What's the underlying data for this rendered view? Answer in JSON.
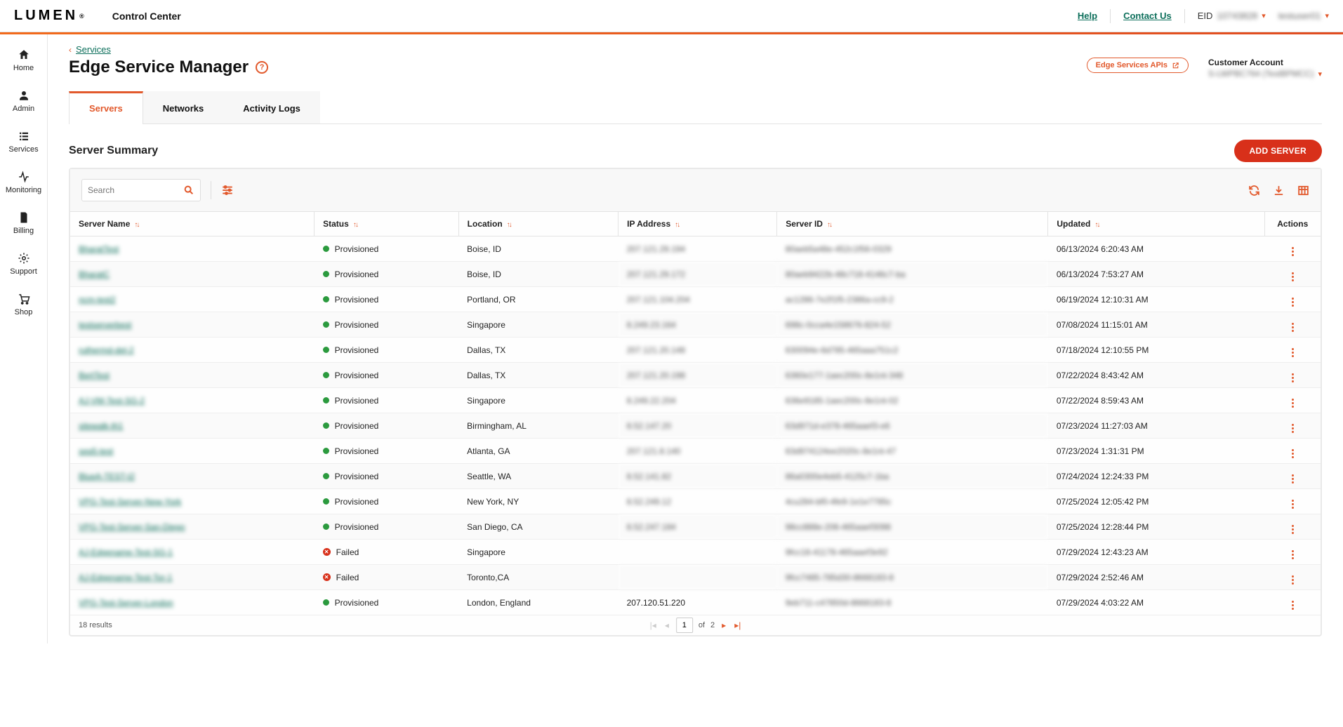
{
  "topbar": {
    "logo_text": "LUMEN",
    "product": "Control Center",
    "help": "Help",
    "contact": "Contact Us",
    "eid_label": "EID",
    "eid_value": "10743828",
    "user_name": "testuser01"
  },
  "sidenav": [
    {
      "label": "Home"
    },
    {
      "label": "Admin"
    },
    {
      "label": "Services"
    },
    {
      "label": "Monitoring"
    },
    {
      "label": "Billing"
    },
    {
      "label": "Support"
    },
    {
      "label": "Shop"
    }
  ],
  "breadcrumb": {
    "parent": "Services"
  },
  "page": {
    "title": "Edge Service Manager",
    "apis_btn": "Edge Services APIs",
    "customer_account_label": "Customer Account",
    "customer_account_value": "S-LWPBC764  (TestBPMCC)"
  },
  "tabs": [
    {
      "label": "Servers",
      "active": true
    },
    {
      "label": "Networks",
      "active": false
    },
    {
      "label": "Activity Logs",
      "active": false
    }
  ],
  "summary": {
    "title": "Server Summary",
    "add_btn": "ADD SERVER",
    "search_placeholder": "Search",
    "columns": [
      "Server Name",
      "Status",
      "Location",
      "IP Address",
      "Server ID",
      "Updated",
      "Actions"
    ],
    "rows": [
      {
        "name": "BharatTest",
        "status": "Provisioned",
        "status_kind": "ok",
        "location": "Boise, ID",
        "ip": "207.121.29.194",
        "server_id": "80aeb5a48e-452c1f56-0329",
        "updated": "06/13/2024 6:20:43 AM"
      },
      {
        "name": "BharatC",
        "status": "Provisioned",
        "status_kind": "ok",
        "location": "Boise, ID",
        "ip": "207.121.29.172",
        "server_id": "80aeb9422b-48c718-4146c7-ba",
        "updated": "06/13/2024 7:53:27 AM"
      },
      {
        "name": "ncm-test2",
        "status": "Provisioned",
        "status_kind": "ok",
        "location": "Portland, OR",
        "ip": "207.121.104.204",
        "server_id": "ac1286-7e2f1f5-2386a-cc9-2",
        "updated": "06/19/2024 12:10:31 AM"
      },
      {
        "name": "testserverbest",
        "status": "Provisioned",
        "status_kind": "ok",
        "location": "Singapore",
        "ip": "8.249.23.164",
        "server_id": "698c-0cca4e158676-824-52",
        "updated": "07/08/2024 11:15:01 AM"
      },
      {
        "name": "ruthermd-del-2",
        "status": "Provisioned",
        "status_kind": "ok",
        "location": "Dallas, TX",
        "ip": "207.121.20.148",
        "server_id": "630094e-6d785-465aaa751c2",
        "updated": "07/18/2024 12:10:55 PM"
      },
      {
        "name": "BertTest",
        "status": "Provisioned",
        "status_kind": "ok",
        "location": "Dallas, TX",
        "ip": "207.121.20.198",
        "server_id": "6360e177-1aec200c-8e1nt-348",
        "updated": "07/22/2024 8:43:42 AM"
      },
      {
        "name": "AJ-VM-Test-SG-2",
        "status": "Provisioned",
        "status_kind": "ok",
        "location": "Singapore",
        "ip": "8.249.22.204",
        "server_id": "636e9185-1aec200c-8e1nt-02",
        "updated": "07/22/2024 8:59:43 AM"
      },
      {
        "name": "sitewalk-th1",
        "status": "Provisioned",
        "status_kind": "ok",
        "location": "Birmingham, AL",
        "ip": "8.52.147.20",
        "server_id": "63d971d-e378-465aaef3-e6",
        "updated": "07/23/2024 11:27:03 AM"
      },
      {
        "name": "seq5-test",
        "status": "Provisioned",
        "status_kind": "ok",
        "location": "Atlanta, GA",
        "ip": "207.121.8.140",
        "server_id": "63d974124ee2020c-8e1nt-47",
        "updated": "07/23/2024 1:31:31 PM"
      },
      {
        "name": "BlueA-TEST-t2",
        "status": "Provisioned",
        "status_kind": "ok",
        "location": "Seattle, WA",
        "ip": "8.52.141.82",
        "server_id": "86a0300e4eb5-4125c7-1ba",
        "updated": "07/24/2024 12:24:33 PM"
      },
      {
        "name": "VPG-Test-Server-New-York",
        "status": "Provisioned",
        "status_kind": "ok",
        "location": "New York, NY",
        "ip": "8.52.249.12",
        "server_id": "4cu284-bf0-4fe9-1e1e7785c",
        "updated": "07/25/2024 12:05:42 PM"
      },
      {
        "name": "VPG-Test-Server-San-Diego",
        "status": "Provisioned",
        "status_kind": "ok",
        "location": "San Diego, CA",
        "ip": "8.52.247.184",
        "server_id": "98cc888e-206-465aaef3098",
        "updated": "07/25/2024 12:28:44 PM"
      },
      {
        "name": "AJ-Edgename-Test-SG-1",
        "status": "Failed",
        "status_kind": "fail",
        "location": "Singapore",
        "ip": "",
        "server_id": "9fcc18-41178-465aaef3e92",
        "updated": "07/29/2024 12:43:23 AM"
      },
      {
        "name": "AJ-Edgename-Test-Tor-1",
        "status": "Failed",
        "status_kind": "fail",
        "location": "Toronto,CA",
        "ip": "",
        "server_id": "9fcc7485-785d30-8668183-8",
        "updated": "07/29/2024 2:52:46 AM"
      },
      {
        "name": "VPG-Test-Server-London",
        "status": "Provisioned",
        "status_kind": "ok",
        "location": "London, England",
        "ip": "207.120.51.220",
        "server_id": "9eb711-c47850d-8668183-8",
        "updated": "07/29/2024 4:03:22 AM"
      }
    ],
    "results_text": "18 results",
    "pager": {
      "page": "1",
      "of_label": "of",
      "total": "2"
    }
  }
}
